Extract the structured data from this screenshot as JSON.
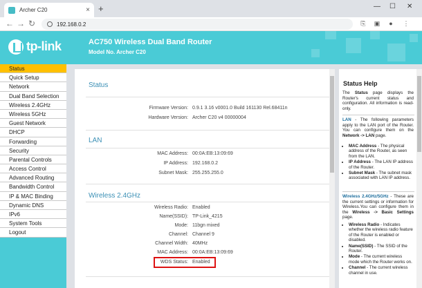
{
  "browser": {
    "tab_title": "Archer C20",
    "tab_close": "×",
    "new_tab": "+",
    "url": "192.168.0.2",
    "window_controls": [
      "—",
      "☐",
      "✕"
    ]
  },
  "router": {
    "logo": "tp-link",
    "title": "AC750 Wireless Dual Band Router",
    "model": "Model No. Archer C20"
  },
  "sidebar": {
    "items": [
      {
        "label": "Status",
        "active": true
      },
      {
        "label": "Quick Setup"
      },
      {
        "label": "Network"
      },
      {
        "label": "Dual Band Selection"
      },
      {
        "label": "Wireless 2.4GHz"
      },
      {
        "label": "Wireless 5GHz"
      },
      {
        "label": "Guest Network"
      },
      {
        "label": "DHCP"
      },
      {
        "label": "Forwarding"
      },
      {
        "label": "Security"
      },
      {
        "label": "Parental Controls"
      },
      {
        "label": "Access Control"
      },
      {
        "label": "Advanced Routing"
      },
      {
        "label": "Bandwidth Control"
      },
      {
        "label": "IP & MAC Binding"
      },
      {
        "label": "Dynamic DNS"
      },
      {
        "label": "IPv6"
      },
      {
        "label": "System Tools"
      },
      {
        "label": "Logout"
      }
    ]
  },
  "main": {
    "status_title": "Status",
    "firmware_label": "Firmware Version:",
    "firmware_value": "0.9.1 3.16 v0001.0 Build 161130 Rel.68411n",
    "hardware_label": "Hardware Version:",
    "hardware_value": "Archer C20 v4 00000004",
    "lan_title": "LAN",
    "lan_mac_label": "MAC Address:",
    "lan_mac_value": "00:0A:EB:13:09:69",
    "lan_ip_label": "IP Address:",
    "lan_ip_value": "192.168.0.2",
    "lan_mask_label": "Subnet Mask:",
    "lan_mask_value": "255.255.255.0",
    "wl_title": "Wireless 2.4GHz",
    "wl_radio_label": "Wireless Radio:",
    "wl_radio_value": "Enabled",
    "wl_ssid_label": "Name(SSID):",
    "wl_ssid_value": "TP-Link_4215",
    "wl_mode_label": "Mode:",
    "wl_mode_value": "11bgn mixed",
    "wl_channel_label": "Channel:",
    "wl_channel_value": "Channel 9",
    "wl_width_label": "Channel Width:",
    "wl_width_value": "40MHz",
    "wl_mac_label": "MAC Address:",
    "wl_mac_value": "00:0A:EB:13:09:69",
    "wl_wds_label": "WDS Status:",
    "wl_wds_value": "Enabled"
  },
  "help": {
    "title": "Status Help",
    "p1_a": "The ",
    "p1_b": "Status",
    "p1_c": " page displays the Router's current status and configuration. All information is read-only.",
    "lan_key": "LAN",
    "lan_text": " - The following parameters apply to the LAN port of the Router. You can configure them on the ",
    "lan_link": "Network -> LAN",
    "lan_end": " page.",
    "li1_k": "MAC Address",
    "li1_t": " - The physical address of the Router, as seen from the LAN.",
    "li2_k": "IP Address",
    "li2_t": " - The LAN IP address of the Router.",
    "li3_k": "Subnet Mask",
    "li3_t": " - The subnet mask associated with LAN IP address.",
    "wl_key": "Wireless 2.4GHz/5GHz",
    "wl_text": " - These are the current settings or information for Wireless.You can configure them in the ",
    "wl_link": "Wireless -> Basic Settings",
    "wl_end": " page.",
    "li4_k": "Wireless Radio",
    "li4_t": " - Indicates whether the wireless radio feature of the Router is enabled or disabled.",
    "li5_k": "Name(SSID)",
    "li5_t": " - The SSID of the Router.",
    "li6_k": "Mode",
    "li6_t": " - The current wireless mode which the Router works on.",
    "li7_k": "Channel",
    "li7_t": " - The current wireless channel in use."
  }
}
